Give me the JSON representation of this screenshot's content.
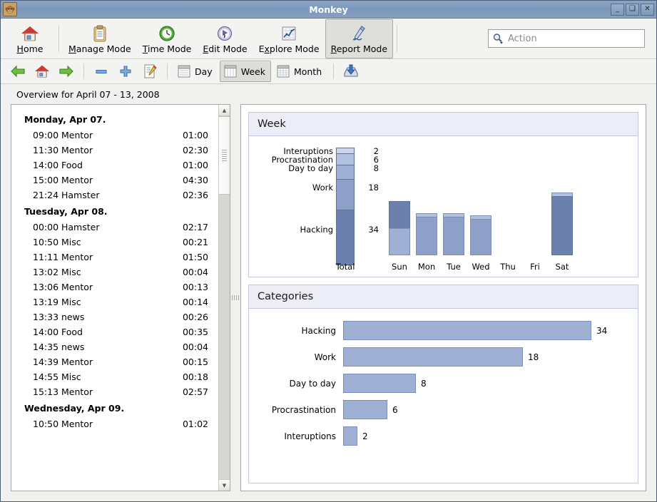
{
  "window": {
    "title": "Monkey",
    "icon": "monkey-icon",
    "buttons": {
      "minimize": "_",
      "maximize": "❑",
      "close": "✕"
    }
  },
  "toolbar": {
    "items": [
      {
        "label": "Home",
        "mnemonic": "H",
        "icon": "home-icon",
        "active": false
      },
      {
        "label": "Manage Mode",
        "mnemonic": "M",
        "icon": "clipboard-icon",
        "active": false
      },
      {
        "label": "Time Mode",
        "mnemonic": "T",
        "icon": "clock-icon",
        "active": false
      },
      {
        "label": "Edit Mode",
        "mnemonic": "E",
        "icon": "edit-icon",
        "active": false
      },
      {
        "label": "Explore Mode",
        "mnemonic": "x",
        "icon": "chart-icon",
        "active": false
      },
      {
        "label": "Report Mode",
        "mnemonic": "R",
        "icon": "pen-icon",
        "active": true
      }
    ],
    "search": {
      "placeholder": "Action",
      "icon": "search-icon",
      "value": ""
    }
  },
  "toolbar2": {
    "nav": [
      {
        "name": "back-button",
        "icon": "arrow-left-icon"
      },
      {
        "name": "home-button",
        "icon": "home-icon"
      },
      {
        "name": "forward-button",
        "icon": "arrow-right-icon"
      }
    ],
    "edit": [
      {
        "name": "remove-button",
        "icon": "minus-icon"
      },
      {
        "name": "add-button",
        "icon": "plus-icon"
      },
      {
        "name": "edit-button",
        "icon": "note-pencil-icon"
      }
    ],
    "views": [
      {
        "label": "Day",
        "icon": "day-view-icon",
        "active": false
      },
      {
        "label": "Week",
        "icon": "week-view-icon",
        "active": true
      },
      {
        "label": "Month",
        "icon": "month-view-icon",
        "active": false
      }
    ],
    "export": {
      "name": "export-button",
      "icon": "save-disk-icon"
    }
  },
  "overview": {
    "text": "Overview for April 07 - 13, 2008"
  },
  "list": {
    "days": [
      {
        "title": "Monday, Apr 07.",
        "entries": [
          {
            "time": "09:00",
            "name": "Mentor",
            "duration": "01:00"
          },
          {
            "time": "11:30",
            "name": "Mentor",
            "duration": "02:30"
          },
          {
            "time": "14:00",
            "name": "Food",
            "duration": "01:00"
          },
          {
            "time": "15:00",
            "name": "Mentor",
            "duration": "04:30"
          },
          {
            "time": "21:24",
            "name": "Hamster",
            "duration": "02:36"
          }
        ]
      },
      {
        "title": "Tuesday, Apr 08.",
        "entries": [
          {
            "time": "00:00",
            "name": "Hamster",
            "duration": "02:17"
          },
          {
            "time": "10:50",
            "name": "Misc",
            "duration": "00:21"
          },
          {
            "time": "11:11",
            "name": "Mentor",
            "duration": "01:50"
          },
          {
            "time": "13:02",
            "name": "Misc",
            "duration": "00:04"
          },
          {
            "time": "13:06",
            "name": "Mentor",
            "duration": "00:13"
          },
          {
            "time": "13:19",
            "name": "Misc",
            "duration": "00:14"
          },
          {
            "time": "13:33",
            "name": "news",
            "duration": "00:26"
          },
          {
            "time": "14:00",
            "name": "Food",
            "duration": "00:35"
          },
          {
            "time": "14:35",
            "name": "news",
            "duration": "00:04"
          },
          {
            "time": "14:39",
            "name": "Mentor",
            "duration": "00:15"
          },
          {
            "time": "14:55",
            "name": "Misc",
            "duration": "00:18"
          },
          {
            "time": "15:13",
            "name": "Mentor",
            "duration": "02:57"
          }
        ]
      },
      {
        "title": "Wednesday, Apr 09.",
        "entries": [
          {
            "time": "10:50",
            "name": "Mentor",
            "duration": "01:02"
          }
        ]
      }
    ]
  },
  "panels": {
    "week": {
      "title": "Week"
    },
    "categories": {
      "title": "Categories"
    }
  },
  "colors": {
    "hacking": "#6b80ad",
    "work": "#8ea0c8",
    "day_to_day": "#9fb0d5",
    "procrastination": "#b3c1e0",
    "interuptions": "#cdd7ec",
    "bar_border": "#5d739f",
    "panel_header_bg": "#ecedf7",
    "panel_border": "#c3c9dd",
    "titlebar": "#7b97ba"
  },
  "chart_data": [
    {
      "type": "bar",
      "title": "Week",
      "orientation": "vertical",
      "stacked": true,
      "xlabel": "",
      "ylabel": "",
      "ylim": [
        0,
        68
      ],
      "grid": false,
      "legend": "inline-labels",
      "total_bar": {
        "category_axis_label": "Total",
        "segments": [
          {
            "label": "Interuptions",
            "value": 2,
            "color": "#cdd7ec"
          },
          {
            "label": "Procrastination",
            "value": 6,
            "color": "#b3c1e0"
          },
          {
            "label": "Day to day",
            "value": 8,
            "color": "#9fb0d5"
          },
          {
            "label": "Work",
            "value": 18,
            "color": "#8ea0c8"
          },
          {
            "label": "Hacking",
            "value": 34,
            "color": "#6b80ad"
          }
        ],
        "total": 68
      },
      "categories": [
        "Sun",
        "Mon",
        "Tue",
        "Wed",
        "Thu",
        "Fri",
        "Sat"
      ],
      "day_bars": [
        {
          "day": "Sun",
          "segments": [
            {
              "color": "#6b80ad",
              "value": 9
            },
            {
              "color": "#9fb0d5",
              "value": 9
            }
          ],
          "total": 18
        },
        {
          "day": "Mon",
          "segments": [
            {
              "color": "#b3c1e0",
              "value": 1
            },
            {
              "color": "#8ea0c8",
              "value": 13
            }
          ],
          "total": 14
        },
        {
          "day": "Tue",
          "segments": [
            {
              "color": "#b3c1e0",
              "value": 1
            },
            {
              "color": "#8ea0c8",
              "value": 13
            }
          ],
          "total": 14
        },
        {
          "day": "Wed",
          "segments": [
            {
              "color": "#b3c1e0",
              "value": 1
            },
            {
              "color": "#8ea0c8",
              "value": 12
            }
          ],
          "total": 13
        },
        {
          "day": "Thu",
          "segments": [],
          "total": 0
        },
        {
          "day": "Fri",
          "segments": [],
          "total": 0
        },
        {
          "day": "Sat",
          "segments": [
            {
              "color": "#b3c1e0",
              "value": 1
            },
            {
              "color": "#6b80ad",
              "value": 20
            }
          ],
          "total": 21
        }
      ]
    },
    {
      "type": "bar",
      "title": "Categories",
      "orientation": "horizontal",
      "stacked": false,
      "xlabel": "",
      "ylabel": "",
      "xlim": [
        0,
        34
      ],
      "grid": false,
      "categories": [
        "Hacking",
        "Work",
        "Day to day",
        "Procrastination",
        "Interuptions"
      ],
      "values": [
        34,
        18,
        8,
        6,
        2
      ],
      "bar_color": "#9fb0d5"
    }
  ]
}
